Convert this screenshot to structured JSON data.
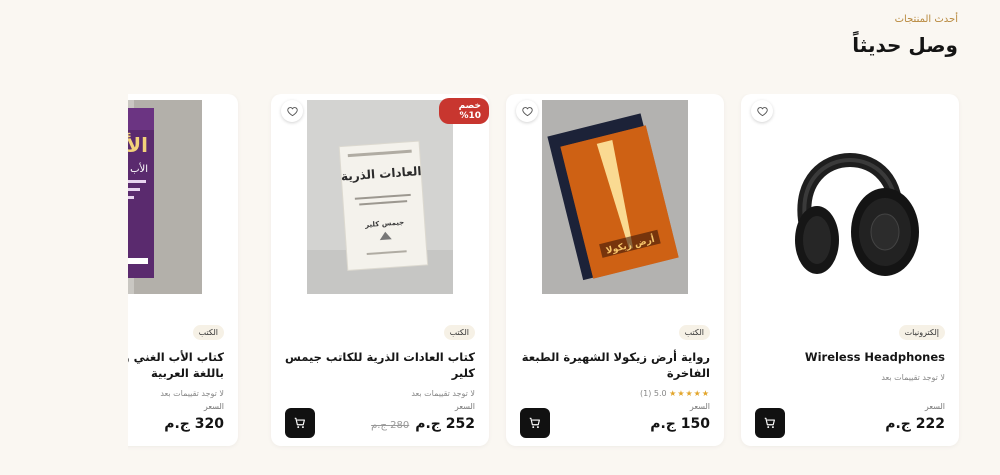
{
  "section": {
    "eyebrow": "أحدث المنتجات",
    "title": "وصل حديثاً"
  },
  "products": [
    {
      "name": "Wireless Headphones",
      "category": "إلكترونيات",
      "rating_text": "لا توجد تقييمات بعد",
      "price_label": "السعر",
      "price": "222 ج.م"
    },
    {
      "name": "رواية أرض زيكولا الشهيرة الطبعة الفاخرة",
      "category": "الكتب",
      "stars": "★★★★★",
      "rating_text": "5.0 (1)",
      "price_label": "السعر",
      "price": "150 ج.م"
    },
    {
      "name": "كتاب العادات الذرية للكاتب جيمس كلير",
      "category": "الكتب",
      "rating_text": "لا توجد تقييمات بعد",
      "price_label": "السعر",
      "price": "252 ج.م",
      "old_price": "280 ج.م",
      "discount": "خصم 10%"
    },
    {
      "name": "كتاب الأب الغني والأب الفقير باللغة العربية",
      "category": "الكتب",
      "rating_text": "لا توجد تقييمات بعد",
      "price_label": "السعر",
      "price": "320 ج.م"
    }
  ],
  "book_covers": {
    "atomic_title": "العادات الذرية",
    "atomic_author": "جيمس كلير",
    "zikola_title": "أرض زيكولا",
    "richdad_title": "الأب الغني",
    "richdad_subtitle": "الأب الفقير"
  },
  "colors": {
    "accent": "#b8893e",
    "discount": "#c8362f",
    "cart_button": "#111111",
    "stars": "#e2a52b"
  },
  "icons": {
    "wishlist": "heart-outline-icon",
    "cart": "cart-icon",
    "star": "star-icon"
  }
}
